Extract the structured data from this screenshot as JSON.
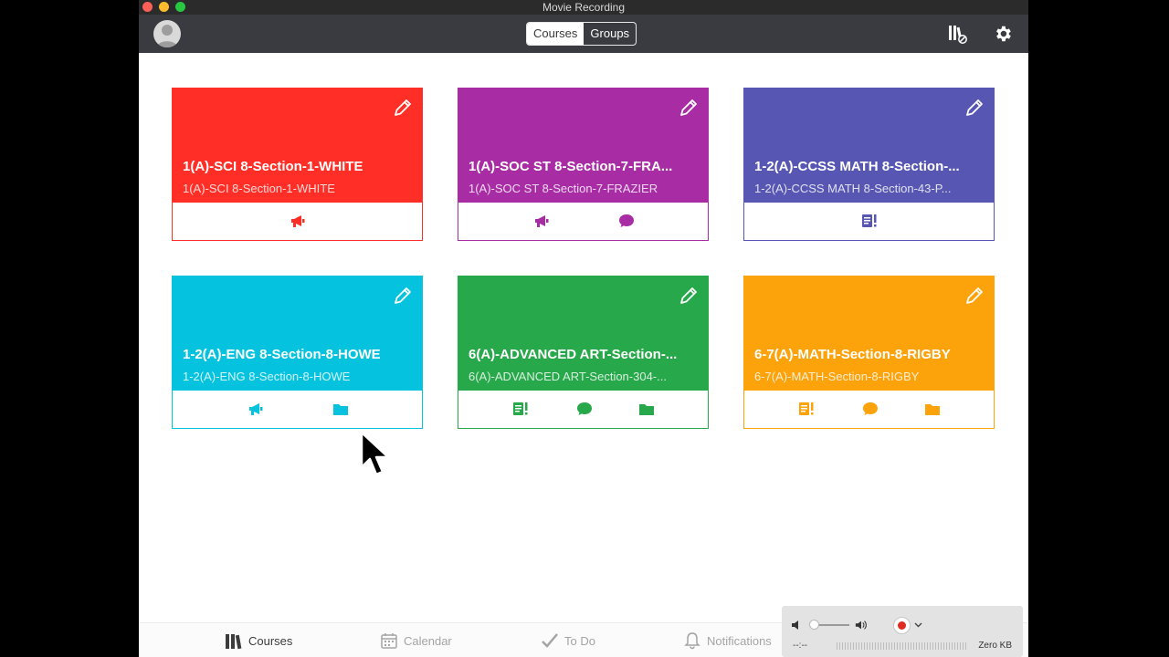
{
  "window": {
    "title": "Movie Recording"
  },
  "header": {
    "segments": [
      "Courses",
      "Groups"
    ],
    "active_segment": "Courses"
  },
  "courses": [
    {
      "title": "1(A)-SCI 8-Section-1-WHITE",
      "subtitle": "1(A)-SCI 8-Section-1-WHITE",
      "color": "#ff2e26",
      "icons": [
        "announcements-icon"
      ]
    },
    {
      "title": "1(A)-SOC ST 8-Section-7-FRA...",
      "subtitle": "1(A)-SOC ST 8-Section-7-FRAZIER",
      "color": "#a82da5",
      "icons": [
        "announcements-icon",
        "discussions-icon"
      ]
    },
    {
      "title": "1-2(A)-CCSS MATH 8-Section-...",
      "subtitle": "1-2(A)-CCSS MATH 8-Section-43-P...",
      "color": "#5757b3",
      "icons": [
        "assignments-icon"
      ]
    },
    {
      "title": "1-2(A)-ENG 8-Section-8-HOWE",
      "subtitle": "1-2(A)-ENG 8-Section-8-HOWE",
      "color": "#05c2de",
      "icons": [
        "announcements-icon",
        "files-icon"
      ]
    },
    {
      "title": "6(A)-ADVANCED ART-Section-...",
      "subtitle": "6(A)-ADVANCED ART-Section-304-...",
      "color": "#27a84b",
      "icons": [
        "assignments-icon",
        "discussions-icon",
        "files-icon"
      ]
    },
    {
      "title": "6-7(A)-MATH-Section-8-RIGBY",
      "subtitle": "6-7(A)-MATH-Section-8-RIGBY",
      "color": "#fca20a",
      "icons": [
        "assignments-icon",
        "discussions-icon",
        "files-icon"
      ]
    }
  ],
  "tabbar": {
    "tabs": [
      {
        "label": "Courses",
        "icon": "courses-icon",
        "active": true
      },
      {
        "label": "Calendar",
        "icon": "calendar-icon",
        "active": false
      },
      {
        "label": "To Do",
        "icon": "checkmark-icon",
        "active": false
      },
      {
        "label": "Notifications",
        "icon": "bell-icon",
        "active": false
      }
    ]
  },
  "recorder": {
    "time": "--:--",
    "size": "Zero KB",
    "record_color": "#e02b20"
  }
}
